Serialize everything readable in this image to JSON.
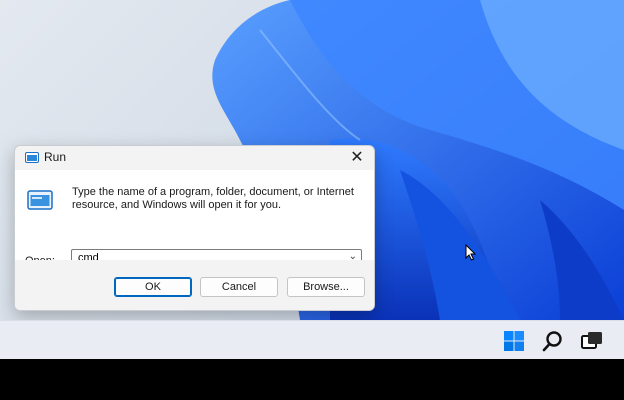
{
  "dialog": {
    "title": "Run",
    "close_glyph": "✕",
    "description": "Type the name of a program, folder, document, or Internet resource, and Windows will open it for you.",
    "open_label": "Open:",
    "open_value": "cmd",
    "dropdown_glyph": "⌄",
    "buttons": {
      "ok": "OK",
      "cancel": "Cancel",
      "browse": "Browse..."
    }
  },
  "taskbar": {
    "icons": [
      "windows-start-icon",
      "search-icon",
      "task-view-icon"
    ]
  },
  "colors": {
    "accent": "#0067c0",
    "wallpaper_blue": "#1a5fe8",
    "taskbar": "#e9edf3"
  }
}
